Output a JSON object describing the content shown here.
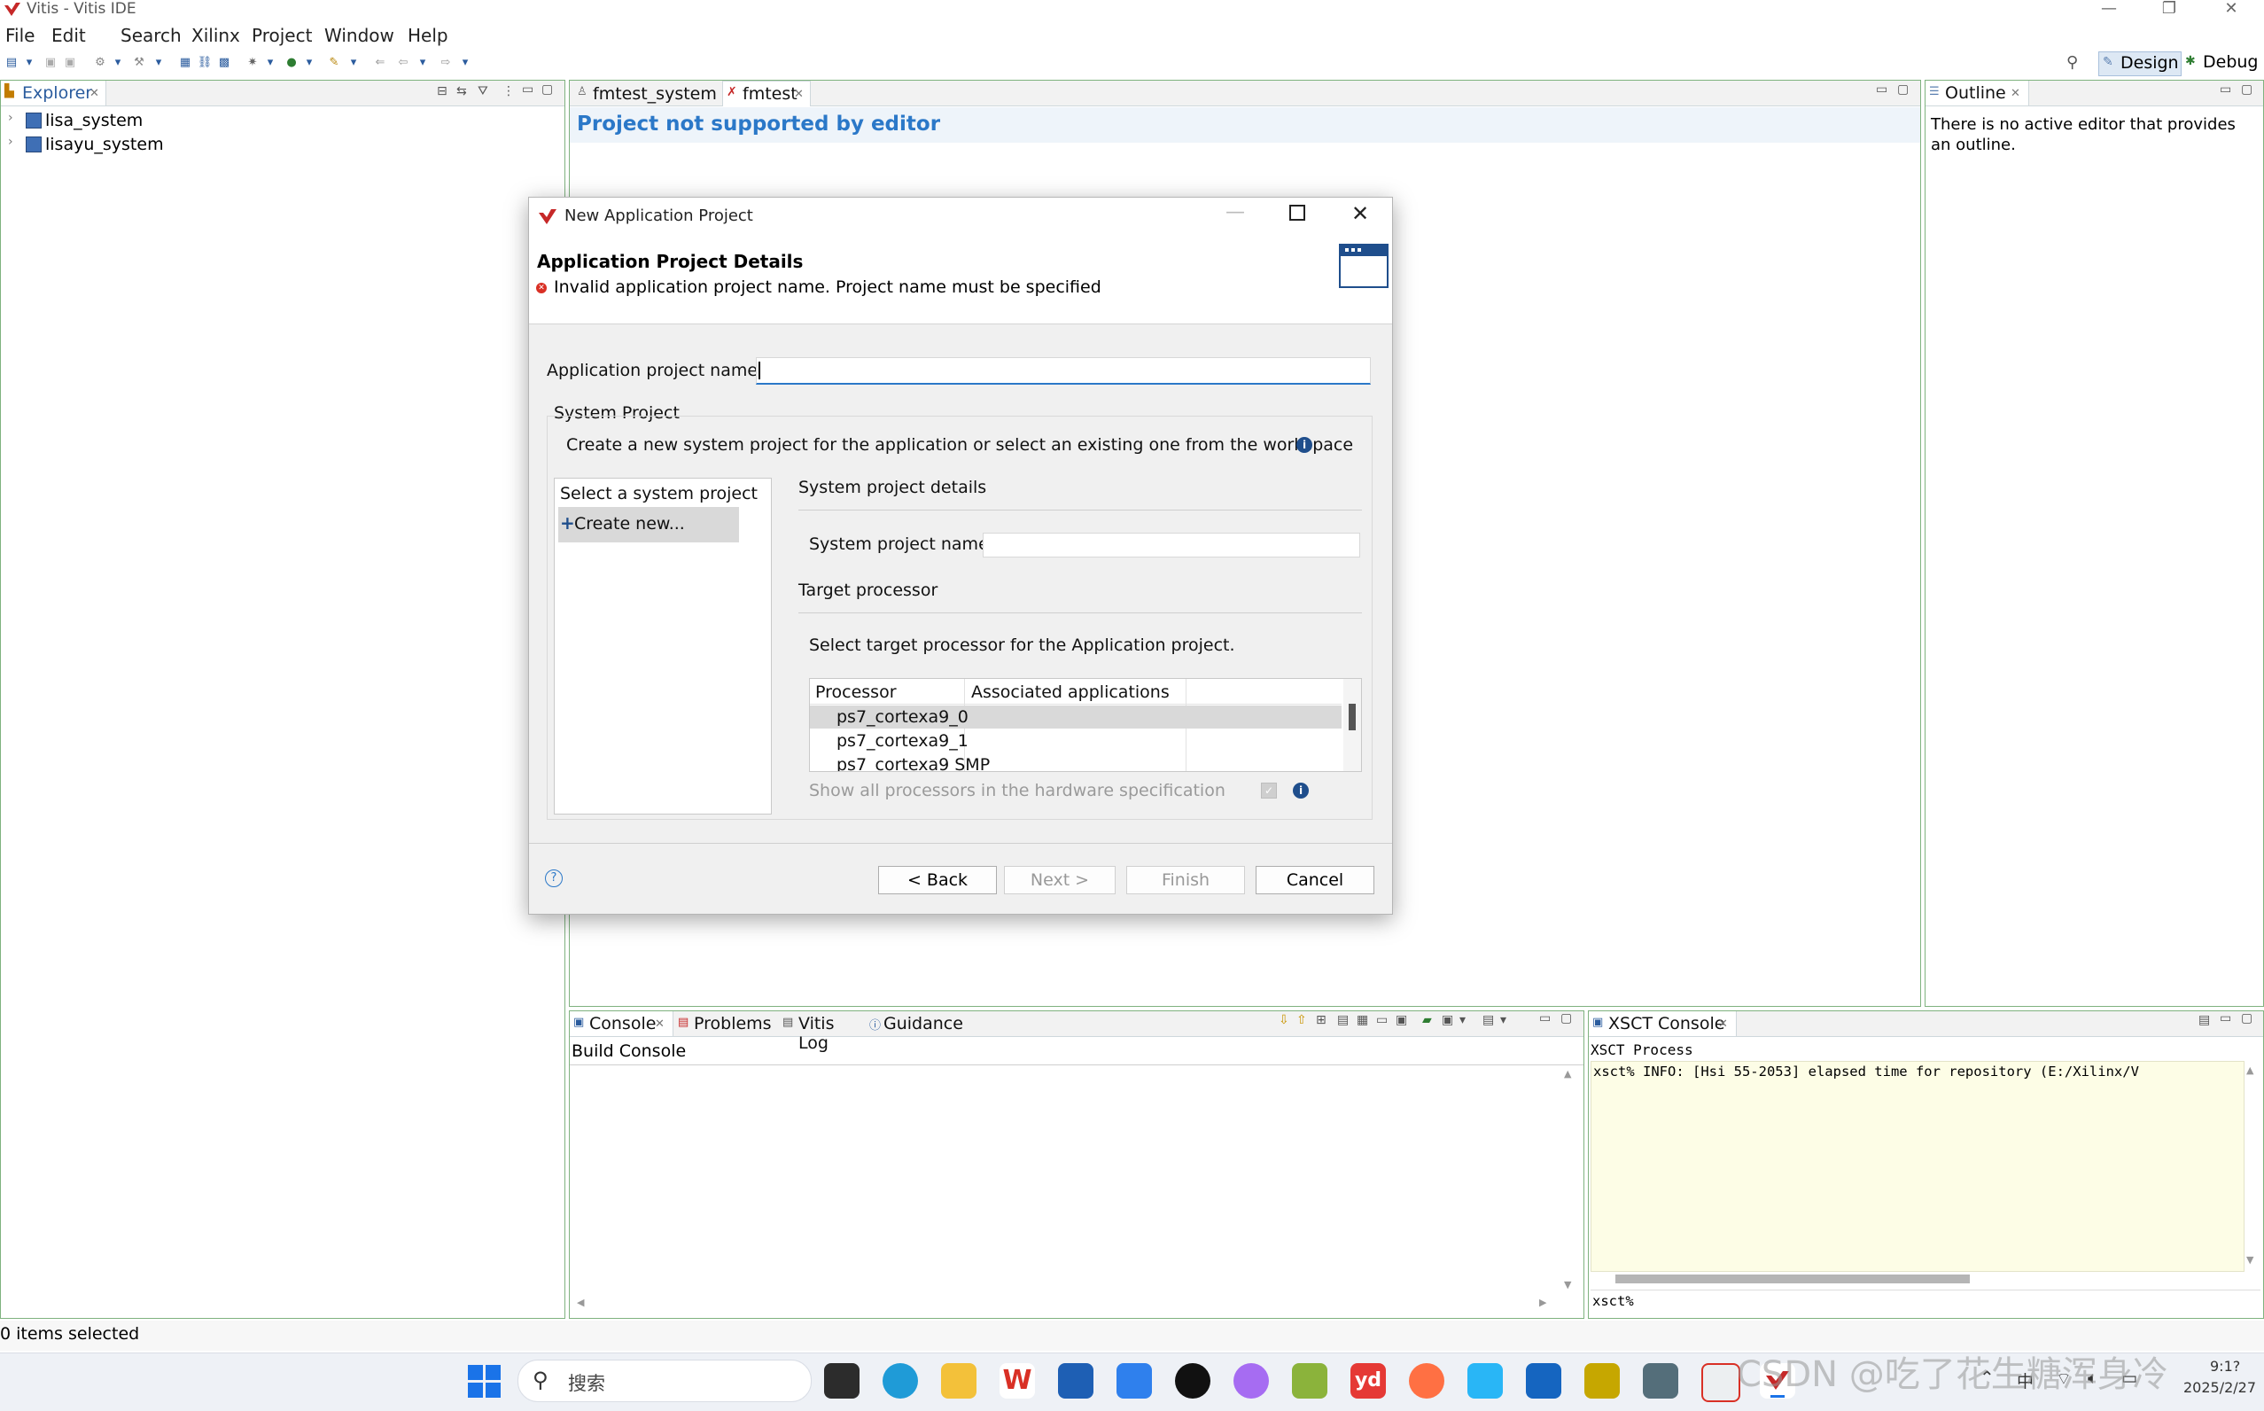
{
  "window": {
    "title": "Vitis - Vitis IDE",
    "buttons": [
      "—",
      "❐",
      "✕"
    ]
  },
  "menu": [
    "File",
    "Edit",
    "Search",
    "Xilinx",
    "Project",
    "Window",
    "Help"
  ],
  "perspectives": {
    "design": "Design",
    "debug": "Debug"
  },
  "explorer": {
    "tab": "Explorer",
    "items": [
      {
        "label": "lisa_system"
      },
      {
        "label": "lisayu_system"
      }
    ]
  },
  "editor": {
    "tabs": [
      "fmtest_system",
      "fmtest"
    ],
    "message": "Project not supported by editor"
  },
  "outline": {
    "tab": "Outline",
    "message": "There is no active editor that provides an outline."
  },
  "console": {
    "tabs": [
      "Console",
      "Problems",
      "Vitis Log",
      "Guidance"
    ],
    "subtitle": "Build Console"
  },
  "xsct": {
    "tab": "XSCT Console",
    "process": "XSCT Process",
    "log_line": "xsct% INFO: [Hsi 55-2053] elapsed time for repository (E:/Xilinx/V",
    "prompt": "xsct%"
  },
  "status": {
    "selection": "0 items selected"
  },
  "dialog": {
    "title": "New Application Project",
    "heading": "Application Project Details",
    "error": "Invalid application project name. Project name must be specified",
    "project_name_label": "Application project name:",
    "project_name_value": "",
    "system_project_group": "System Project",
    "system_project_desc": "Create a new system project for the application or select an existing one from the workspace",
    "list_header": "Select a system project",
    "list_items": [
      "Create new..."
    ],
    "details_heading": "System project details",
    "system_name_label": "System project name:",
    "system_name_value": "",
    "target_heading": "Target processor",
    "target_desc": "Select target processor for the Application project.",
    "table": {
      "columns": [
        "Processor",
        "Associated applications"
      ],
      "rows": [
        "ps7_cortexa9_0",
        "ps7_cortexa9_1",
        "ps7_cortexa9 SMP"
      ]
    },
    "show_all_label": "Show all processors in the hardware specification",
    "buttons": {
      "back": "< Back",
      "next": "Next >",
      "finish": "Finish",
      "cancel": "Cancel"
    }
  },
  "taskbar": {
    "search": "搜索",
    "clock": {
      "time": "9:1?",
      "date": "2025/2/27"
    },
    "input_method": "中",
    "watermark": "CSDN @吃了花生糖浑身冷"
  }
}
